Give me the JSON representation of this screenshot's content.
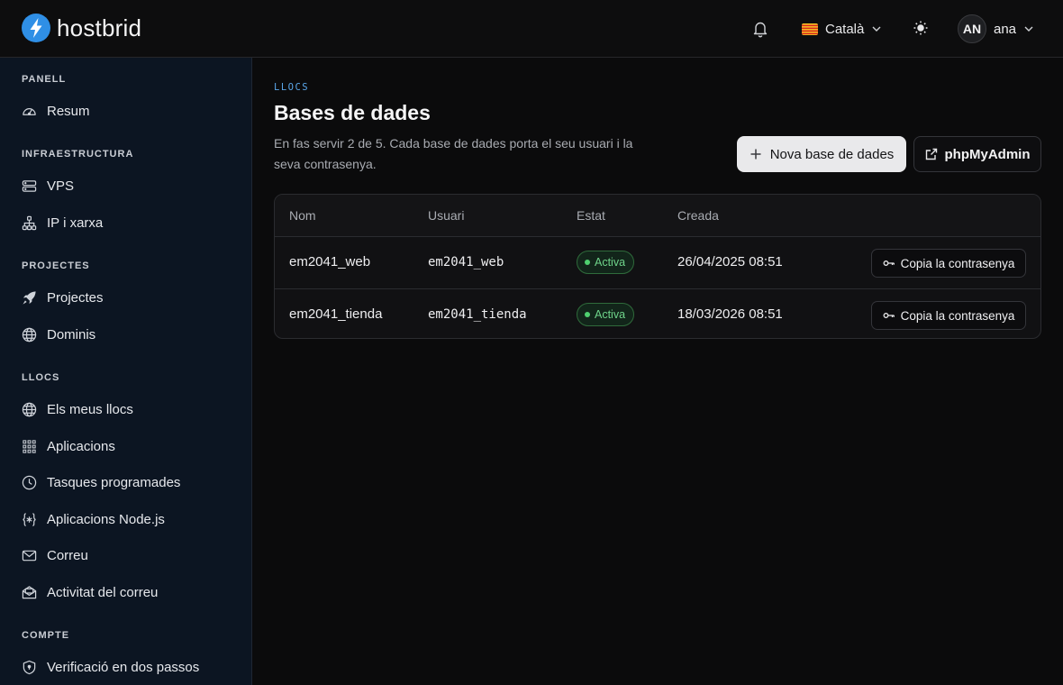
{
  "header": {
    "brand": "hostbrid",
    "language": "Català",
    "avatar_initials": "AN",
    "user_name": "ana"
  },
  "sidebar": {
    "sections": [
      {
        "title": "PANELL",
        "items": [
          {
            "label": "Resum",
            "icon": "gauge-icon"
          }
        ]
      },
      {
        "title": "INFRAESTRUCTURA",
        "items": [
          {
            "label": "VPS",
            "icon": "server-icon"
          },
          {
            "label": "IP i xarxa",
            "icon": "network-icon"
          }
        ]
      },
      {
        "title": "PROJECTES",
        "items": [
          {
            "label": "Projectes",
            "icon": "rocket-icon"
          },
          {
            "label": "Dominis",
            "icon": "globe-icon"
          }
        ]
      },
      {
        "title": "LLOCS",
        "items": [
          {
            "label": "Els meus llocs",
            "icon": "globe-icon"
          },
          {
            "label": "Aplicacions",
            "icon": "grid-icon"
          },
          {
            "label": "Tasques programades",
            "icon": "clock-icon"
          },
          {
            "label": "Aplicacions Node.js",
            "icon": "code-braces-icon"
          },
          {
            "label": "Correu",
            "icon": "mail-icon"
          },
          {
            "label": "Activitat del correu",
            "icon": "mail-open-icon"
          }
        ]
      },
      {
        "title": "COMPTE",
        "items": [
          {
            "label": "Verificació en dos passos",
            "icon": "shield-icon"
          }
        ]
      }
    ]
  },
  "main": {
    "eyebrow": "LLOCS",
    "title": "Bases de dades",
    "subtitle": "En fas servir 2 de 5. Cada base de dades porta el seu usuari i la seva contrasenya.",
    "new_button": "Nova base de dades",
    "phpmyadmin_button": "phpMyAdmin",
    "table": {
      "columns": [
        "Nom",
        "Usuari",
        "Estat",
        "Creada"
      ],
      "rows": [
        {
          "name": "em2041_web",
          "user": "em2041_web",
          "status": "Activa",
          "created": "26/04/2025 08:51",
          "action": "Copia la contrasenya"
        },
        {
          "name": "em2041_tienda",
          "user": "em2041_tienda",
          "status": "Activa",
          "created": "18/03/2026 08:51",
          "action": "Copia la contrasenya"
        }
      ]
    }
  },
  "colors": {
    "accent_blue": "#5aa6e8",
    "brand_blue": "#2f8fe6",
    "status_green": "#4fd06f",
    "sidebar_bg": "#0c1522"
  }
}
